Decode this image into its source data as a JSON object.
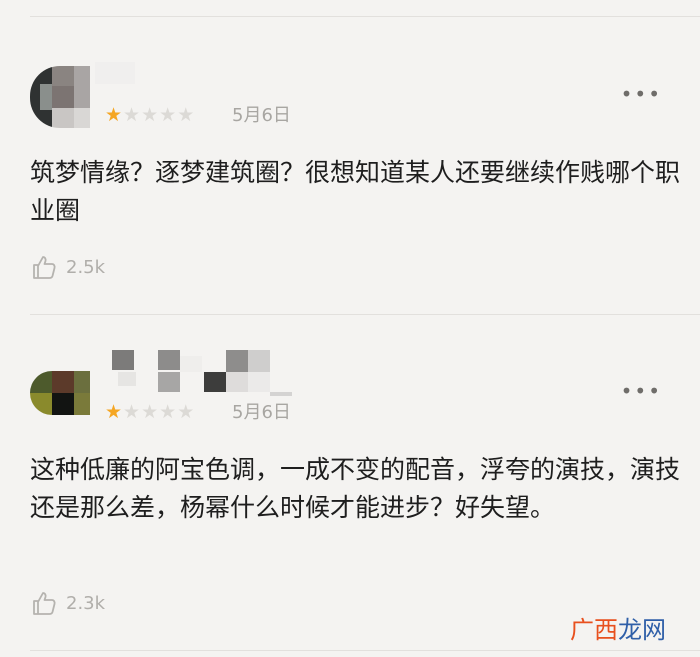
{
  "reviews": [
    {
      "rating": 1,
      "max_rating": 5,
      "date": "5月6日",
      "more_icon": "more-dots-icon",
      "text": "筑梦情缘？逐梦建筑圈？很想知道某人还要继续作贱哪个职业圈",
      "likes": "2.5k",
      "like_icon": "thumbs-up-icon"
    },
    {
      "rating": 1,
      "max_rating": 5,
      "date": "5月6日",
      "more_icon": "more-dots-icon",
      "text": "这种低廉的阿宝色调，一成不变的配音，浮夸的演技，演技还是那么差，杨幂什么时候才能进步？好失望。",
      "likes": "2.3k",
      "like_icon": "thumbs-up-icon"
    }
  ],
  "watermark": {
    "text_part1": "广西",
    "text_part2": "龙网",
    "color1": "#e8501e",
    "color2": "#2f5fa8"
  }
}
